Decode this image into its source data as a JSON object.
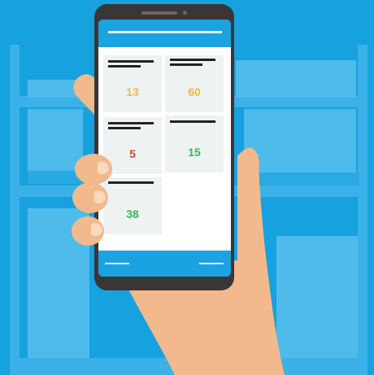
{
  "tiles": [
    {
      "value": "13",
      "color": "#f7b733"
    },
    {
      "value": "60",
      "color": "#f7b733"
    },
    {
      "value": "5",
      "color": "#e8442c"
    },
    {
      "value": "15",
      "color": "#2ebd4f"
    },
    {
      "value": "38",
      "color": "#2ebd4f"
    }
  ],
  "colors": {
    "background": "#16a1df",
    "accent": "#1aa3e0",
    "skin": "#f2b98c",
    "phone": "#3a3537"
  }
}
